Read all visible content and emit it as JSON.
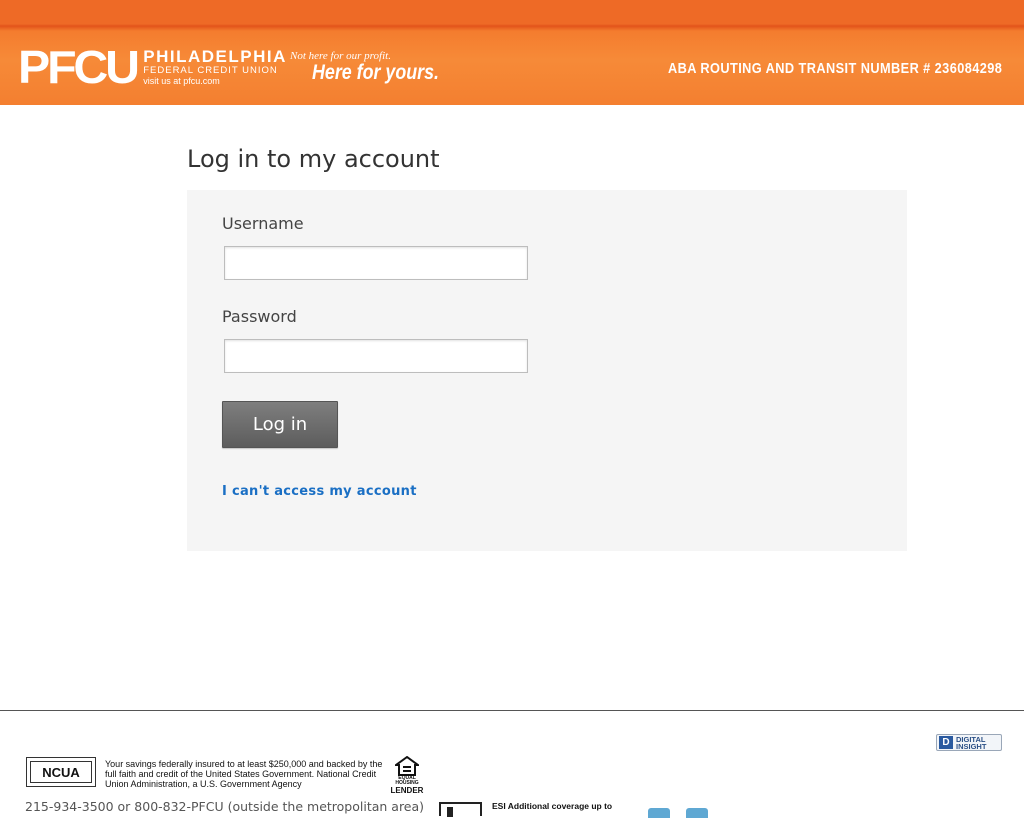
{
  "header": {
    "logo_mark": "PFCU",
    "logo_line1": "PHILADELPHIA",
    "logo_line2": "FEDERAL CREDIT UNION",
    "logo_line3": "visit us at pfcu.com",
    "tagline_small": "Not here for our profit.",
    "tagline_large": "Here for yours.",
    "routing": "ABA ROUTING AND TRANSIT NUMBER # 236084298",
    "colors": {
      "banner": "#f47f30",
      "banner_top": "#ee6a26"
    }
  },
  "login": {
    "title": "Log in to my account",
    "username_label": "Username",
    "username_value": "",
    "password_label": "Password",
    "password_value": "",
    "submit_label": "Log in",
    "help_link": "I can't access my account",
    "colors": {
      "panel": "#f5f5f5",
      "button": "#6e6e6e",
      "link": "#1a6fc4"
    }
  },
  "footer": {
    "digital_insight_mark": "D",
    "digital_insight_line1": "DIGITAL",
    "digital_insight_line2": "INSIGHT",
    "ncua_label": "NCUA",
    "insured_text": "Your savings federally insured to at least $250,000 and backed by the full faith and credit of the United States Government. National Credit Union Administration, a U.S. Government Agency",
    "ehl_label": "EQUAL HOUSING",
    "ehl_label2": "LENDER",
    "phone": "215-934-3500 or 800-832-PFCU (outside the metropolitan area)",
    "esi_text": "ESI Additional coverage up to",
    "icons": [
      "house-icon",
      "twitter-icon",
      "facebook-icon"
    ]
  }
}
